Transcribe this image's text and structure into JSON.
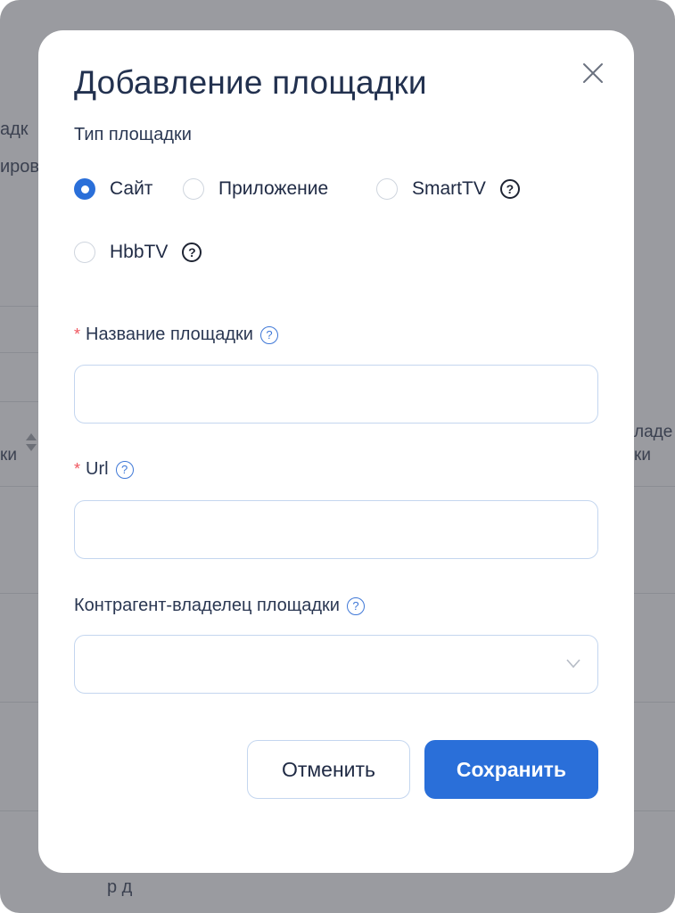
{
  "background": {
    "text_fragments": [
      "адк",
      "иров",
      "ки",
      "ладе",
      "ки",
      "р д"
    ]
  },
  "modal": {
    "title": "Добавление площадки",
    "close_icon": "close-icon",
    "platform_type": {
      "label": "Тип площадки",
      "options": [
        {
          "label": "Сайт",
          "checked": true
        },
        {
          "label": "Приложение",
          "checked": false
        },
        {
          "label": "SmartTV",
          "checked": false,
          "help": true
        },
        {
          "label": "HbbTV",
          "checked": false,
          "help": true
        }
      ]
    },
    "name_field": {
      "label": "Название площадки",
      "required": true,
      "value": "",
      "placeholder": ""
    },
    "url_field": {
      "label": "Url",
      "required": true,
      "value": "",
      "placeholder": ""
    },
    "owner_field": {
      "label": "Контрагент-владелец площадки",
      "required": false,
      "selected": ""
    },
    "buttons": {
      "cancel": "Отменить",
      "save": "Сохранить"
    },
    "help_glyph": "?",
    "required_mark": "*"
  },
  "colors": {
    "primary": "#2a6fd9",
    "required": "#f0565f",
    "title": "#22314f",
    "backdrop": "#9a9ba0"
  }
}
